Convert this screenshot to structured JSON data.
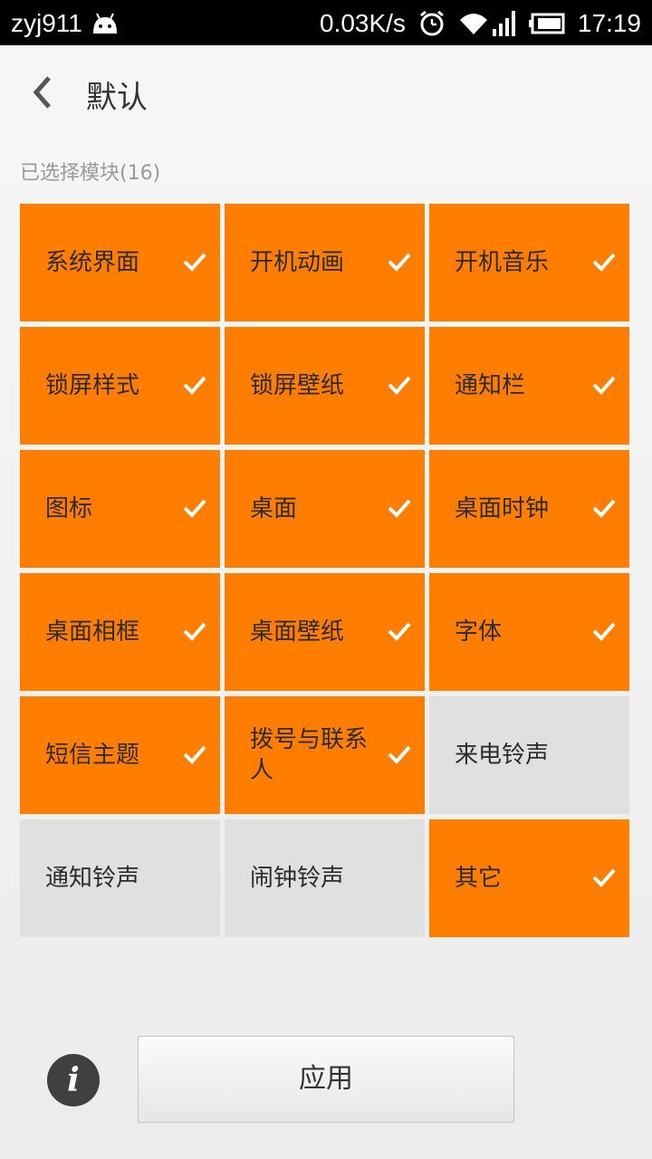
{
  "status_bar": {
    "user": "zyj911",
    "speed": "0.03K/s",
    "time": "17:19"
  },
  "header": {
    "title": "默认"
  },
  "section": {
    "label": "已选择模块(16)"
  },
  "modules": [
    {
      "label": "系统界面",
      "selected": true
    },
    {
      "label": "开机动画",
      "selected": true
    },
    {
      "label": "开机音乐",
      "selected": true
    },
    {
      "label": "锁屏样式",
      "selected": true
    },
    {
      "label": "锁屏壁纸",
      "selected": true
    },
    {
      "label": "通知栏",
      "selected": true
    },
    {
      "label": "图标",
      "selected": true
    },
    {
      "label": "桌面",
      "selected": true
    },
    {
      "label": "桌面时钟",
      "selected": true
    },
    {
      "label": "桌面相框",
      "selected": true
    },
    {
      "label": "桌面壁纸",
      "selected": true
    },
    {
      "label": "字体",
      "selected": true
    },
    {
      "label": "短信主题",
      "selected": true
    },
    {
      "label": "拨号与联系人",
      "selected": true
    },
    {
      "label": "来电铃声",
      "selected": false
    },
    {
      "label": "通知铃声",
      "selected": false
    },
    {
      "label": "闹钟铃声",
      "selected": false
    },
    {
      "label": "其它",
      "selected": true
    }
  ],
  "footer": {
    "info_icon": "i",
    "apply_label": "应用"
  },
  "colors": {
    "selected": "#ff7e00",
    "unselected": "#e0e0e0"
  }
}
